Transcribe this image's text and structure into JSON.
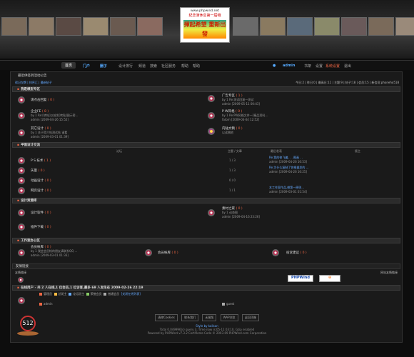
{
  "banner": {
    "url": "www.phpwind.net",
    "slogan": "紀念演休息第一屆哦",
    "logo_text": "揮起希望 重新出發"
  },
  "nav": {
    "home": "首页",
    "portal": "门户",
    "circle": "圈子",
    "links": [
      "设计排行",
      "频道",
      "搜索",
      "社区服务",
      "帮助",
      "帮助"
    ],
    "user": "admin",
    "user_links": [
      "书架",
      "设置",
      "系统设置",
      "退出"
    ]
  },
  "notice": "最近供签到活动公告",
  "bar_left": "帮记仅牌 | 排序汇 | 最新帖子",
  "bar_right": "今日:2 | 昨日:0 | 最高日:11 | 主题:9 | 帖子:18 | 会员:15 | 新会员:phoneho518",
  "section1": {
    "title": "我是模型专区",
    "forums": [
      {
        "name": "请点击回复",
        "count": "( 0 )",
        "sub": "",
        "meta": ""
      },
      {
        "name": "广告专区",
        "count": "( 1 )",
        "sub": "by 1 Re:测试回复一测试",
        "meta": "admin [2009-05-11 00:43]"
      },
      {
        "name": "企业FE",
        "count": "( 8 )",
        "sub": "by 1 Re:[转帖]以前发[转贴]图示帮...",
        "meta": "admin [2009-04-26 15:52]"
      },
      {
        "name": "P W风格",
        "count": "( 0 )",
        "sub": "by 1 Re:PW风格文件—[精品资料...",
        "meta": "fatom [2009-04-04 12:52]"
      },
      {
        "name": "其它设计",
        "count": "( 0 )",
        "sub": "by 1 关于简介帖测试帖 请看",
        "meta": "admin [2009-03-01 01:39]"
      },
      {
        "name": "内陆文稿",
        "count": "( 0 )",
        "sub": "以读稿地",
        "meta": ""
      }
    ]
  },
  "section2": {
    "title": "平面设计交流",
    "cols": [
      "论坛",
      "主题 / 文章",
      "最后发表",
      "版主"
    ],
    "forums": [
      {
        "name": "P S 技术",
        "count": "( 1 )",
        "topics": "1 / 3",
        "last": "Re:我的修飞编, . . 图画 . .",
        "meta": "admin [2009-04-26 16:53]"
      },
      {
        "name": "矢量",
        "count": "( 0 )",
        "topics": "1 / 3",
        "last": "Re:为什么复制了你根据发的 ...",
        "meta": "admin [2009-04-26 16:25]"
      },
      {
        "name": "动画设计",
        "count": "( 0 )",
        "topics": "0 / 0",
        "last": "",
        "meta": ""
      },
      {
        "name": "网页设计",
        "count": "( 0 )",
        "topics": "1 / 1",
        "last": "本工作室作品,做第一原则...",
        "meta": "admin [2009-03-01 01:54]"
      }
    ]
  },
  "section3": {
    "title": "设计资源库",
    "forums": [
      {
        "name": "设计软件",
        "count": "( 0 )",
        "sub": "",
        "meta": ""
      },
      {
        "name": "素材之家",
        "count": "( 0 )",
        "sub": "by 1 动态图",
        "meta": "admin [2009-04-16 23:26]"
      },
      {
        "name": "插件下载",
        "count": "( 0 )",
        "sub": "",
        "meta": ""
      }
    ]
  },
  "section4": {
    "title": "工作室办公区",
    "forums": [
      {
        "name": "会员帐库",
        "count": "( 0 )",
        "sub": "by 1 我会会员帐的朋友请联系QQ ...",
        "meta": "admin [2009-03-01 01:33]"
      },
      {
        "name": "会员帐库",
        "count": "( 0 )",
        "sub": "",
        "meta": ""
      },
      {
        "name": "投诉建议",
        "count": "( 0 )",
        "sub": "",
        "meta": ""
      }
    ]
  },
  "links": {
    "title": "友情链接",
    "sub": "友情链接",
    "right": "网站友情链接"
  },
  "online": {
    "title": "在线用户 - 共 2 人在线,1 位会员,1 位访客,最多 69 人发生在 2009-02-26 22:19",
    "legend": [
      "管理员",
      "总斑主",
      "论坛斑主",
      "荣誉会员",
      "普通会员",
      "[关闭在线列表]"
    ],
    "users": [
      "admin",
      "guest"
    ]
  },
  "footer": {
    "buttons": [
      "清除Cookies",
      "联系我们",
      "无图版",
      "WAP浏览",
      "返回顶端"
    ],
    "line1": "Style by kalison",
    "line2": "Total 0.049996(s) query 3, Time now is:05-11 03:10, Gzip enabled",
    "line3": "Powered by PHPWind v7.3.2 Certificate Code © 2003-09 PHPWind.com Corporation"
  }
}
